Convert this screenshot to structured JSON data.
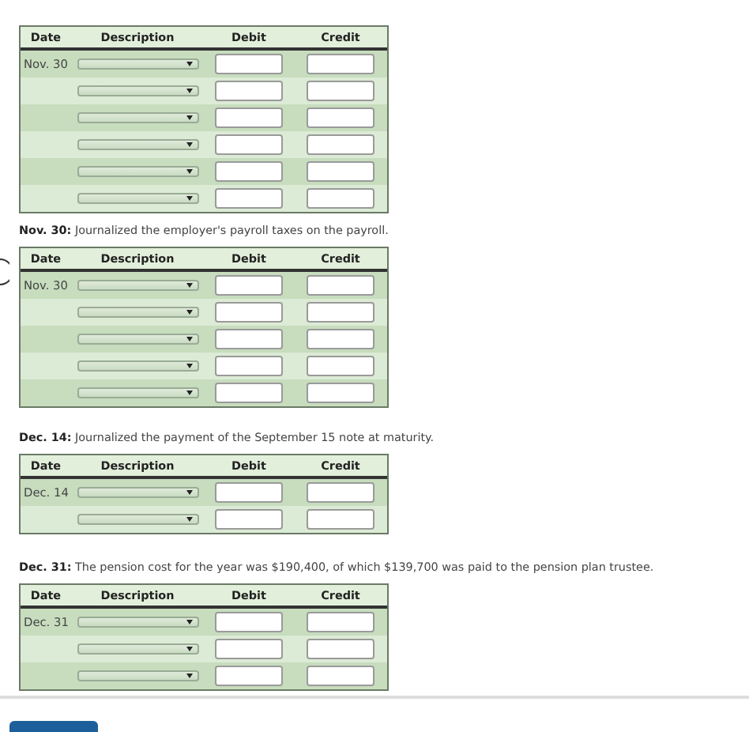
{
  "journal_entries": [
    {
      "columns": [
        "Date",
        "Description",
        "Debit",
        "Credit"
      ],
      "rows": [
        {
          "kind": "dated",
          "date": "Nov. 30"
        },
        {
          "kind": "blank"
        },
        {
          "kind": "blank"
        },
        {
          "kind": "blank"
        },
        {
          "kind": "blank"
        },
        {
          "kind": "blank"
        }
      ]
    },
    {
      "caption": "**Nov. 30:** Journalized the employer's payroll taxes on the payroll.",
      "columns": [
        "Date",
        "Description",
        "Debit",
        "Credit"
      ],
      "rows": [
        {
          "kind": "dated",
          "date": "Nov. 30"
        },
        {
          "kind": "blank"
        },
        {
          "kind": "blank"
        },
        {
          "kind": "blank"
        },
        {
          "kind": "blank"
        }
      ]
    },
    {
      "caption": "**Dec. 14:** Journalized the payment of the September 15 note at maturity.",
      "columns": [
        "Date",
        "Description",
        "Debit",
        "Credit"
      ],
      "rows": [
        {
          "kind": "dated",
          "date": "Dec. 14"
        },
        {
          "kind": "blank"
        }
      ]
    },
    {
      "caption": "**Dec. 31:** The pension cost for the year was $190,400, of which $139,700 was paid to the pension plan trustee.",
      "columns": [
        "Date",
        "Description",
        "Debit",
        "Credit"
      ],
      "rows": [
        {
          "kind": "dated",
          "date": "Dec. 31"
        },
        {
          "kind": "blank"
        },
        {
          "kind": "blank"
        }
      ]
    }
  ]
}
